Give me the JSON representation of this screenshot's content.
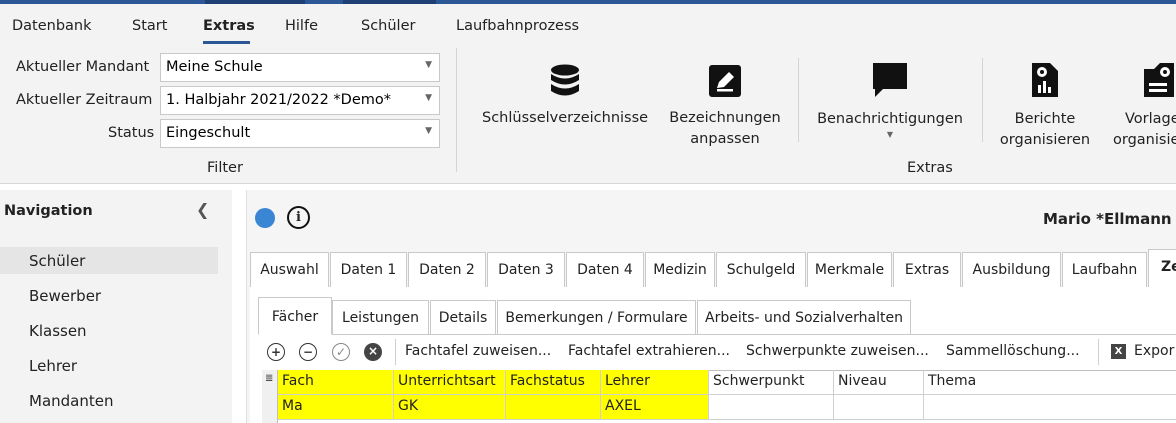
{
  "menu": {
    "tabs": [
      "Datenbank",
      "Start",
      "Extras",
      "Hilfe",
      "Schüler",
      "Laufbahnprozess"
    ],
    "active_tab": "Extras"
  },
  "filter": {
    "mandant_label": "Aktueller Mandant",
    "mandant_value": "Meine Schule",
    "zeitraum_label": "Aktueller Zeitraum",
    "zeitraum_value": "1. Halbjahr 2021/2022 *Demo*",
    "status_label": "Status",
    "status_value": "Eingeschult",
    "group_label": "Filter"
  },
  "extras": {
    "schluessel": "Schlüsselverzeichnisse",
    "bezeichnungen_1": "Bezeichnungen",
    "bezeichnungen_2": "anpassen",
    "benachrichtigungen": "Benachrichtigungen",
    "berichte_1": "Berichte",
    "berichte_2": "organisieren",
    "vorlagen_1": "Vorlage",
    "vorlagen_2": "organisie",
    "group_label": "Extras"
  },
  "navigation": {
    "title": "Navigation",
    "items": [
      "Schüler",
      "Bewerber",
      "Klassen",
      "Lehrer",
      "Mandanten"
    ],
    "active_index": 0
  },
  "student": {
    "name": "Mario *Ellmann"
  },
  "tabs_main": [
    "Auswahl",
    "Daten 1",
    "Daten 2",
    "Daten 3",
    "Daten 4",
    "Medizin",
    "Schulgeld",
    "Merkmale",
    "Extras",
    "Ausbildung",
    "Laufbahn",
    "Ze"
  ],
  "tabs_sub": [
    "Fächer",
    "Leistungen",
    "Details",
    "Bemerkungen / Formulare",
    "Arbeits- und Sozialverhalten"
  ],
  "toolbar": {
    "fachtafel_zuweisen": "Fachtafel zuweisen...",
    "fachtafel_extrahieren": "Fachtafel extrahieren...",
    "schwerpunkte_zuweisen": "Schwerpunkte zuweisen...",
    "sammelloeschung": "Sammellöschung...",
    "export": "Expor"
  },
  "grid": {
    "headers": [
      "Fach",
      "Unterrichtsart",
      "Fachstatus",
      "Lehrer",
      "Schwerpunkt",
      "Niveau",
      "Thema"
    ],
    "rows": [
      [
        "Ma",
        "GK",
        "",
        "AXEL",
        "",
        "",
        ""
      ]
    ]
  },
  "colors": {
    "accent": "#2b5797",
    "highlight": "#ffff00",
    "status_dot": "#3a85d4"
  }
}
